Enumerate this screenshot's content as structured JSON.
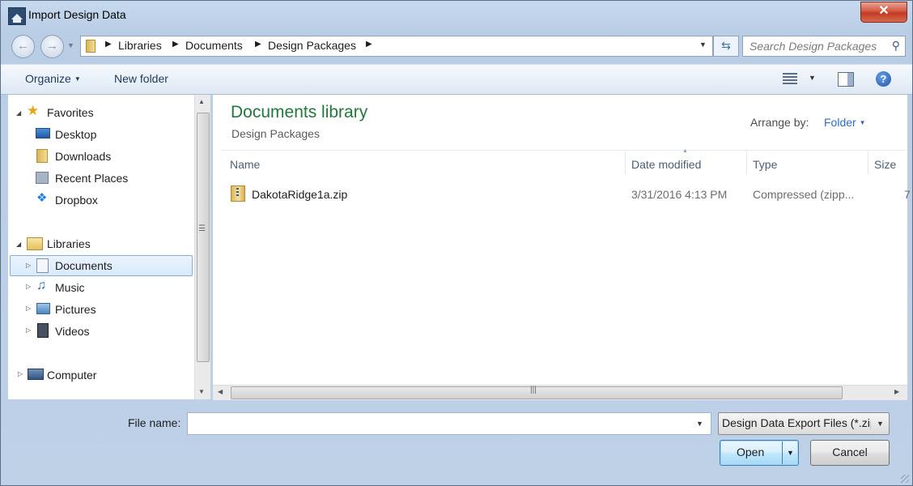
{
  "window": {
    "title": "Import Design Data",
    "close_glyph": "✕"
  },
  "navigation": {
    "back_glyph": "←",
    "forward_glyph": "→",
    "breadcrumbs": [
      "Libraries",
      "Documents",
      "Design Packages"
    ],
    "search_placeholder": "Search Design Packages"
  },
  "toolbar": {
    "organize_label": "Organize",
    "new_folder_label": "New folder",
    "help_glyph": "?"
  },
  "sidebar": {
    "favorites": {
      "label": "Favorites",
      "items": [
        "Desktop",
        "Downloads",
        "Recent Places",
        "Dropbox"
      ]
    },
    "libraries": {
      "label": "Libraries",
      "items": [
        "Documents",
        "Music",
        "Pictures",
        "Videos"
      ],
      "selected": "Documents"
    },
    "computer": {
      "label": "Computer"
    }
  },
  "content": {
    "library_title": "Documents library",
    "library_subtitle": "Design Packages",
    "arrange_label": "Arrange by:",
    "arrange_value": "Folder",
    "columns": [
      "Name",
      "Date modified",
      "Type",
      "Size"
    ],
    "files": [
      {
        "name": "DakotaRidge1a.zip",
        "date_modified": "3/31/2016 4:13 PM",
        "type": "Compressed (zipp...",
        "size": "7"
      }
    ]
  },
  "footer": {
    "file_name_label": "File name:",
    "file_name_value": "",
    "file_type_value": "Design Data Export Files (*.zip)",
    "open_label": "Open",
    "cancel_label": "Cancel"
  },
  "colors": {
    "library_title": "#1f7a3a",
    "link_blue": "#2b6cc4",
    "close_red": "#c23a22"
  }
}
